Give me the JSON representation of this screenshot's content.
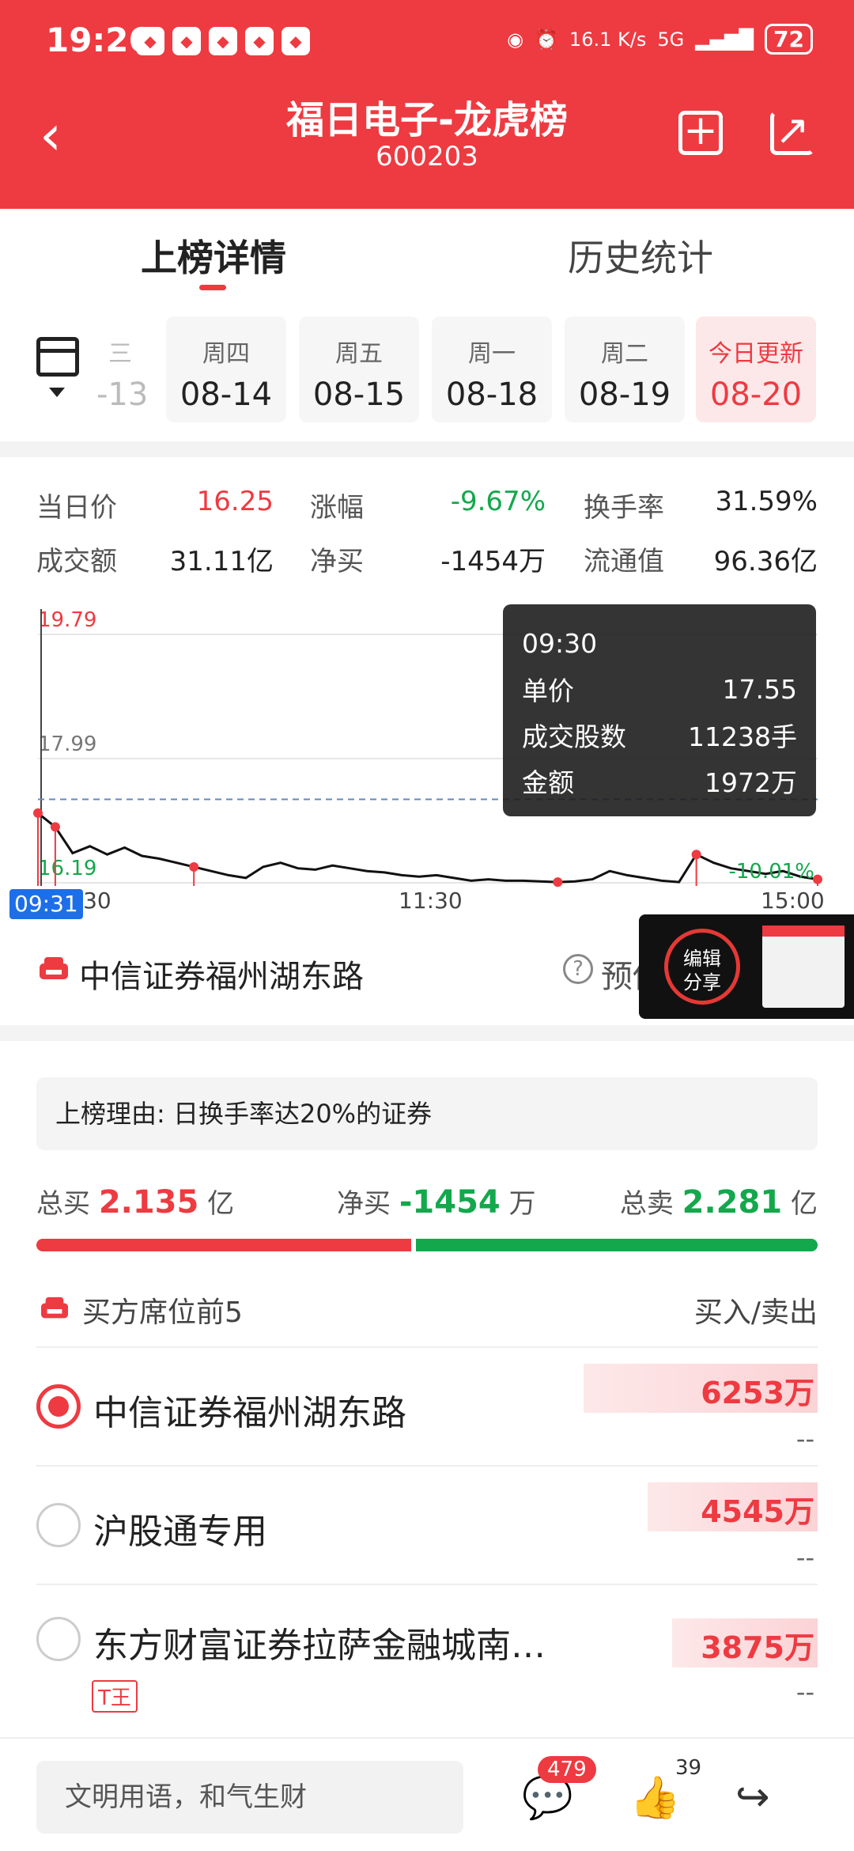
{
  "status_bar": {
    "time": "19:26",
    "speed": "16.1 K/s",
    "network": "5G",
    "battery": "72"
  },
  "header": {
    "title": "福日电子-龙虎榜",
    "code": "600203"
  },
  "tabs": [
    {
      "label": "上榜详情",
      "active": true
    },
    {
      "label": "历史统计",
      "active": false
    }
  ],
  "dates": [
    {
      "weekday": "三",
      "date": "-13",
      "partial": true
    },
    {
      "weekday": "周四",
      "date": "08-14"
    },
    {
      "weekday": "周五",
      "date": "08-15"
    },
    {
      "weekday": "周一",
      "date": "08-18"
    },
    {
      "weekday": "周二",
      "date": "08-19"
    },
    {
      "weekday": "今日更新",
      "date": "08-20",
      "today": true
    }
  ],
  "stats": {
    "price_label": "当日价",
    "price": "16.25",
    "change_label": "涨幅",
    "change": "-9.67%",
    "turnover_label": "换手率",
    "turnover": "31.59%",
    "volume_label": "成交额",
    "volume": "31.11亿",
    "netbuy_label": "净买",
    "netbuy": "-1454万",
    "float_label": "流通值",
    "float_value": "96.36亿"
  },
  "chart_data": {
    "type": "line",
    "y_ticks": [
      "19.79",
      "17.99",
      "16.19"
    ],
    "y_right_label": "-10.01%",
    "x_ticks": [
      "09:30",
      "11:30",
      "15:00"
    ],
    "x_start_badge": "09:31",
    "ylim": [
      16.19,
      19.79
    ],
    "reference_price": 17.99,
    "series": [
      {
        "values": [
          17.2,
          17.0,
          16.62,
          16.72,
          16.6,
          16.7,
          16.58,
          16.54,
          16.48,
          16.42,
          16.36,
          16.3,
          16.26,
          16.42,
          16.48,
          16.4,
          16.38,
          16.44,
          16.4,
          16.36,
          16.34,
          16.3,
          16.28,
          16.3,
          16.26,
          16.22,
          16.24,
          16.22,
          16.22,
          16.21,
          16.2,
          16.21,
          16.24,
          16.36,
          16.3,
          16.26,
          16.22,
          16.2,
          16.6,
          16.48,
          16.4,
          16.36,
          16.32,
          16.36,
          16.28,
          16.24
        ]
      }
    ],
    "tooltip": {
      "time": "09:30",
      "rows": [
        {
          "label": "单价",
          "value": "17.55"
        },
        {
          "label": "成交股数",
          "value": "11238手"
        },
        {
          "label": "金额",
          "value": "1972万"
        }
      ]
    }
  },
  "broker": {
    "name": "中信证券福州湖东路",
    "estimate_label": "预估"
  },
  "float_panel": {
    "edit_label": "编辑\n分享"
  },
  "reason": {
    "label": "上榜理由: 日换手率达20%的证券"
  },
  "totals": {
    "buy_label": "总买",
    "buy_value": "2.135",
    "buy_unit": "亿",
    "net_label": "净买",
    "net_value": "-1454",
    "net_unit": "万",
    "sell_label": "总卖",
    "sell_value": "2.281",
    "sell_unit": "亿",
    "buy_fraction": 0.483
  },
  "seats": {
    "title": "买方席位前5",
    "columns": "买入/卖出",
    "items": [
      {
        "name": "中信证券福州湖东路",
        "buy": "6253万",
        "sell": "--",
        "selected": true,
        "bar_fraction": 1.0
      },
      {
        "name": "沪股通专用",
        "buy": "4545万",
        "sell": "--",
        "selected": false,
        "bar_fraction": 0.727
      },
      {
        "name": "东方财富证券拉萨金融城南…",
        "buy": "3875万",
        "sell": "--",
        "selected": false,
        "tag": "T王",
        "bar_fraction": 0.62
      }
    ]
  },
  "bottom_bar": {
    "input_placeholder": "文明用语，和气生财",
    "comment_count": "479",
    "like_count": "39"
  }
}
